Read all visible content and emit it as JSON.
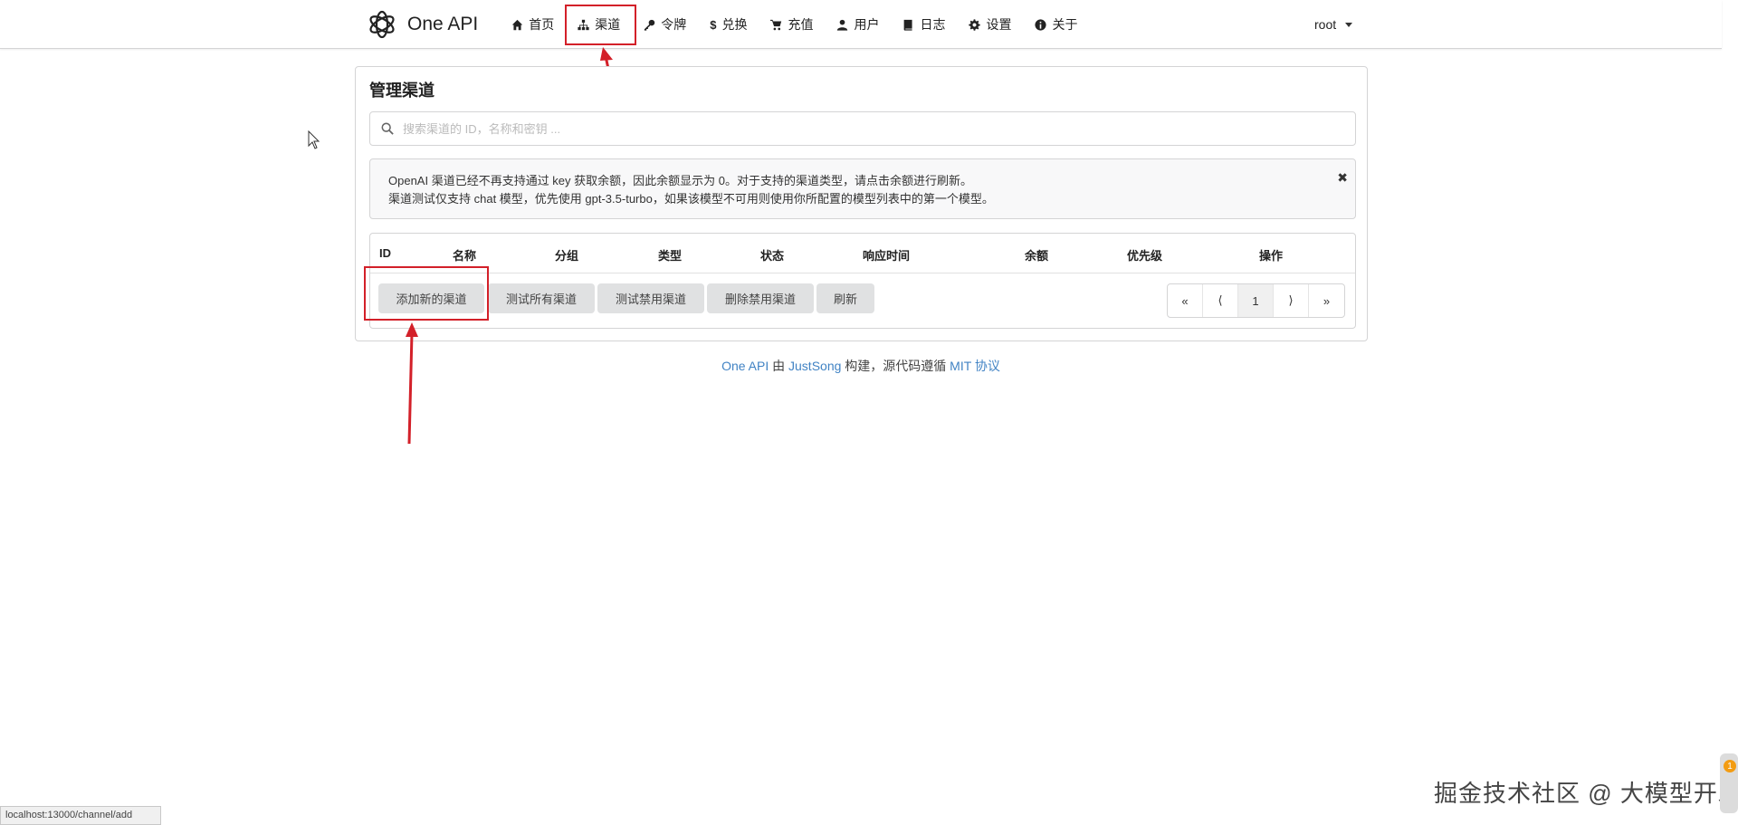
{
  "nav": {
    "brand": "One API",
    "items": [
      {
        "label": "首页",
        "icon": "home-icon"
      },
      {
        "label": "渠道",
        "icon": "sitemap-icon"
      },
      {
        "label": "令牌",
        "icon": "key-icon"
      },
      {
        "label": "兑换",
        "icon": "dollar-icon"
      },
      {
        "label": "充值",
        "icon": "cart-icon"
      },
      {
        "label": "用户",
        "icon": "user-icon"
      },
      {
        "label": "日志",
        "icon": "book-icon"
      },
      {
        "label": "设置",
        "icon": "gear-icon"
      },
      {
        "label": "关于",
        "icon": "info-icon"
      }
    ],
    "user": "root"
  },
  "page": {
    "title": "管理渠道",
    "search_placeholder": "搜索渠道的 ID，名称和密钥 ...",
    "notice": {
      "line1": "OpenAI 渠道已经不再支持通过 key 获取余额，因此余额显示为 0。对于支持的渠道类型，请点击余额进行刷新。",
      "line2": "渠道测试仅支持 chat 模型，优先使用 gpt-3.5-turbo，如果该模型不可用则使用你所配置的模型列表中的第一个模型。",
      "close": "✖"
    },
    "table": {
      "headers": [
        "ID",
        "名称",
        "分组",
        "类型",
        "状态",
        "响应时间",
        "余额",
        "优先级",
        "操作"
      ]
    },
    "buttons": {
      "add": "添加新的渠道",
      "test_all": "测试所有渠道",
      "test_disabled": "测试禁用渠道",
      "delete_disabled": "删除禁用渠道",
      "refresh": "刷新"
    },
    "pager": {
      "first": "«",
      "prev": "⟨",
      "current": "1",
      "next": "⟩",
      "last": "»"
    }
  },
  "footer": {
    "project": "One API",
    "by": " 由 ",
    "author": "JustSong",
    "built": " 构建，源代码遵循 ",
    "license": "MIT 协议"
  },
  "status_url": "localhost:13000/channel/add",
  "watermark": "掘金技术社区 @ 大模型开发",
  "scroll_badge": "1",
  "colors": {
    "highlight": "#d32029",
    "link": "#4183c4",
    "button_bg": "#e0e1e2"
  }
}
